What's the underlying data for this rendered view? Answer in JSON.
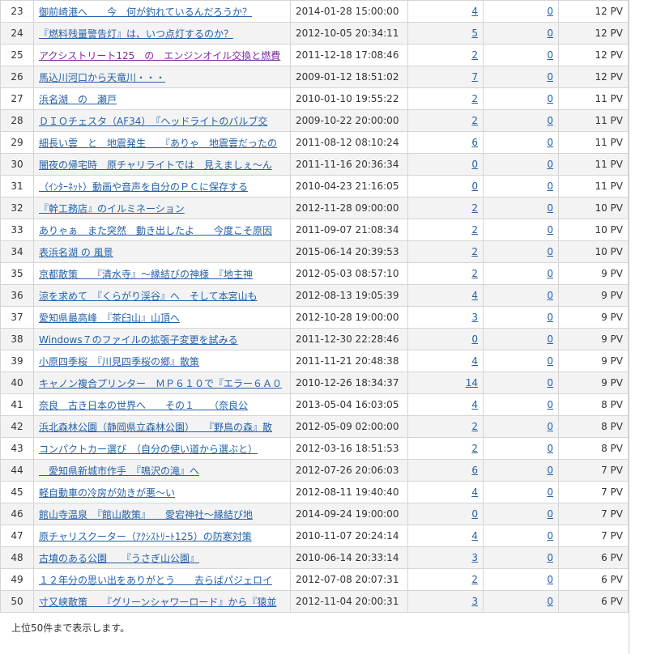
{
  "ranking": {
    "rows": [
      {
        "rank": "23",
        "title": "御前崎港へ　　今　何が釣れているんだろうか？",
        "date": "2014-01-28 15:00:00",
        "comments": "4",
        "trackbacks": "0",
        "pv": "12 PV"
      },
      {
        "rank": "24",
        "title": "『燃料残量警告灯』は、いつ点灯するのか？",
        "date": "2012-10-05 20:34:11",
        "comments": "5",
        "trackbacks": "0",
        "pv": "12 PV"
      },
      {
        "rank": "25",
        "title": "アクシストリート125　の　エンジンオイル交換と燃費",
        "date": "2011-12-18 17:08:46",
        "comments": "2",
        "trackbacks": "0",
        "pv": "12 PV",
        "visited": true
      },
      {
        "rank": "26",
        "title": "馬込川河口から天竜川・・・",
        "date": "2009-01-12 18:51:02",
        "comments": "7",
        "trackbacks": "0",
        "pv": "12 PV"
      },
      {
        "rank": "27",
        "title": "浜名湖　の　瀬戸",
        "date": "2010-01-10 19:55:22",
        "comments": "2",
        "trackbacks": "0",
        "pv": "11 PV"
      },
      {
        "rank": "28",
        "title": "ＤＩＯチェスタ（AF34）　『ヘッドライトのバルブ交",
        "date": "2009-10-22 20:00:00",
        "comments": "2",
        "trackbacks": "0",
        "pv": "11 PV"
      },
      {
        "rank": "29",
        "title": "細長い雲　と　地震発生　　『ありゃ　地震雲だったの",
        "date": "2011-08-12 08:10:24",
        "comments": "6",
        "trackbacks": "0",
        "pv": "11 PV"
      },
      {
        "rank": "30",
        "title": "闇夜の帰宅時　原チャリライトでは　見えましぇ～ん",
        "date": "2011-11-16 20:36:34",
        "comments": "0",
        "trackbacks": "0",
        "pv": "11 PV"
      },
      {
        "rank": "31",
        "title": "（ｲﾝﾀｰﾈｯﾄ）動画や音声を自分のＰＣに保存する",
        "date": "2010-04-23 21:16:05",
        "comments": "0",
        "trackbacks": "0",
        "pv": "11 PV"
      },
      {
        "rank": "32",
        "title": "『幹工務店』のイルミネーション",
        "date": "2012-11-28 09:00:00",
        "comments": "2",
        "trackbacks": "0",
        "pv": "10 PV"
      },
      {
        "rank": "33",
        "title": "ありゃぁ　また突然　動き出したよ　　今度こそ原因",
        "date": "2011-09-07 21:08:34",
        "comments": "2",
        "trackbacks": "0",
        "pv": "10 PV"
      },
      {
        "rank": "34",
        "title": "表浜名湖 の 風景",
        "date": "2015-06-14 20:39:53",
        "comments": "2",
        "trackbacks": "0",
        "pv": "10 PV"
      },
      {
        "rank": "35",
        "title": "京都散策　　『清水寺』～縁結びの神様　『地主神",
        "date": "2012-05-03 08:57:10",
        "comments": "2",
        "trackbacks": "0",
        "pv": "9 PV"
      },
      {
        "rank": "36",
        "title": "涼を求めて　『くらがり渓谷』へ　そして本宮山も",
        "date": "2012-08-13 19:05:39",
        "comments": "4",
        "trackbacks": "0",
        "pv": "9 PV"
      },
      {
        "rank": "37",
        "title": "愛知県最高峰　『茶臼山』山頂へ",
        "date": "2012-10-28 19:00:00",
        "comments": "3",
        "trackbacks": "0",
        "pv": "9 PV"
      },
      {
        "rank": "38",
        "title": "Windows７のファイルの拡張子変更を試みる",
        "date": "2011-12-30 22:28:46",
        "comments": "0",
        "trackbacks": "0",
        "pv": "9 PV"
      },
      {
        "rank": "39",
        "title": "小原四季桜　『川見四季桜の郷』散策",
        "date": "2011-11-21 20:48:38",
        "comments": "4",
        "trackbacks": "0",
        "pv": "9 PV"
      },
      {
        "rank": "40",
        "title": "キャノン複合プリンター　ＭＰ６１０で『エラー６Ａ０",
        "date": "2010-12-26 18:34:37",
        "comments": "14",
        "trackbacks": "0",
        "pv": "9 PV"
      },
      {
        "rank": "41",
        "title": "奈良　古き日本の世界へ　　その１　　（奈良公",
        "date": "2013-05-04 16:03:05",
        "comments": "4",
        "trackbacks": "0",
        "pv": "8 PV"
      },
      {
        "rank": "42",
        "title": "浜北森林公園（静岡県立森林公園）　　『野鳥の森』散",
        "date": "2012-05-09 02:00:00",
        "comments": "2",
        "trackbacks": "0",
        "pv": "8 PV"
      },
      {
        "rank": "43",
        "title": "コンパクトカー選び　（自分の使い道から選ぶと）",
        "date": "2012-03-16 18:51:53",
        "comments": "2",
        "trackbacks": "0",
        "pv": "8 PV"
      },
      {
        "rank": "44",
        "title": "　愛知県新城市作手　『鳴沢の滝』へ",
        "date": "2012-07-26 20:06:03",
        "comments": "6",
        "trackbacks": "0",
        "pv": "7 PV"
      },
      {
        "rank": "45",
        "title": "軽自動車の冷房が効きが悪～い",
        "date": "2012-08-11 19:40:40",
        "comments": "4",
        "trackbacks": "0",
        "pv": "7 PV"
      },
      {
        "rank": "46",
        "title": "館山寺温泉　『館山散策』　　愛宕神社～縁結び地",
        "date": "2014-09-24 19:00:00",
        "comments": "0",
        "trackbacks": "0",
        "pv": "7 PV"
      },
      {
        "rank": "47",
        "title": "原チャリスクーター（ｱｸｼｽﾄﾘｰﾄ125）の防寒対策",
        "date": "2010-11-07 20:24:14",
        "comments": "4",
        "trackbacks": "0",
        "pv": "7 PV"
      },
      {
        "rank": "48",
        "title": "古墳のある公園　　『うさぎ山公園』",
        "date": "2010-06-14 20:33:14",
        "comments": "3",
        "trackbacks": "0",
        "pv": "6 PV"
      },
      {
        "rank": "49",
        "title": "１２年分の思い出をありがとう　　去らばパジェロイ",
        "date": "2012-07-08 20:07:31",
        "comments": "2",
        "trackbacks": "0",
        "pv": "6 PV"
      },
      {
        "rank": "50",
        "title": "寸又峡散策　　『グリーンシャワーロード』から『猿並",
        "date": "2012-11-04 20:00:31",
        "comments": "3",
        "trackbacks": "0",
        "pv": "6 PV"
      }
    ]
  },
  "footer": {
    "note": "上位50件まで表示します。"
  },
  "colors": {
    "link": "#2561a8",
    "visited_link": "#7a2c9e",
    "row_alt": "#f3f3f3",
    "border": "#d5d5d5"
  }
}
